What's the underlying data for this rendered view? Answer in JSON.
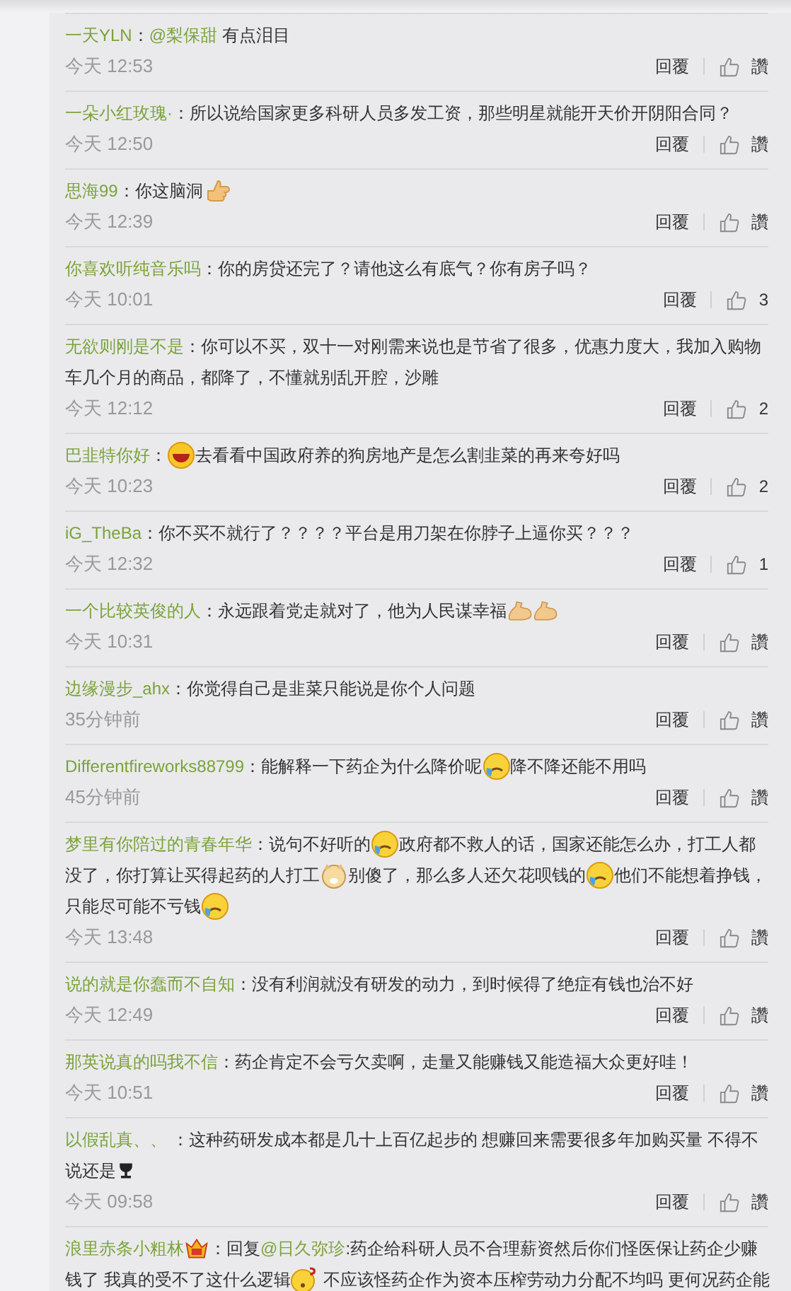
{
  "comments": [
    {
      "author": "一天YLN",
      "lines": [
        [
          {
            "kind": "text",
            "text": "："
          },
          {
            "kind": "mention",
            "text": "@梨保甜"
          },
          {
            "kind": "text",
            "text": " 有点泪目"
          }
        ]
      ],
      "time": "今天 12:53",
      "reply": "回覆",
      "likes": "讚"
    },
    {
      "author": "一朵小红玫瑰·",
      "lines": [
        [
          {
            "kind": "text",
            "text": "：所以说给国家更多科研人员多发工资，那些明星就能开天价开阴阳合同？"
          }
        ]
      ],
      "time": "今天 12:50",
      "reply": "回覆",
      "likes": "讚"
    },
    {
      "author": "思海99",
      "lines": [
        [
          {
            "kind": "text",
            "text": "：你这脑洞"
          },
          {
            "kind": "thumb"
          }
        ]
      ],
      "time": "今天 12:39",
      "reply": "回覆",
      "likes": "讚"
    },
    {
      "author": "你喜欢听纯音乐吗",
      "lines": [
        [
          {
            "kind": "text",
            "text": "：你的房贷还完了？请他这么有底气？你有房子吗？"
          }
        ]
      ],
      "time": "今天 10:01",
      "reply": "回覆",
      "likes": "3"
    },
    {
      "author": "无欲则刚是不是",
      "lines": [
        [
          {
            "kind": "text",
            "text": "：你可以不买，双十一对刚需来说也是节省了很多，优惠力度大，我加入购物"
          }
        ],
        [
          {
            "kind": "text",
            "text": "车几个月的商品，都降了，不懂就别乱开腔，沙雕"
          }
        ]
      ],
      "time": "今天 12:12",
      "reply": "回覆",
      "likes": "2"
    },
    {
      "author": "巴韭特你好",
      "lines": [
        [
          {
            "kind": "text",
            "text": "："
          },
          {
            "kind": "laugh"
          },
          {
            "kind": "text",
            "text": "去看看中国政府养的狗房地产是怎么割韭菜的再来夸好吗"
          }
        ]
      ],
      "time": "今天 10:23",
      "reply": "回覆",
      "likes": "2"
    },
    {
      "author": "iG_TheBa",
      "lines": [
        [
          {
            "kind": "text",
            "text": "：你不买不就行了？？？？平台是用刀架在你脖子上逼你买？？？"
          }
        ]
      ],
      "time": "今天 12:32",
      "reply": "回覆",
      "likes": "1"
    },
    {
      "author": "一个比较英俊的人",
      "lines": [
        [
          {
            "kind": "text",
            "text": "：永远跟着党走就对了，他为人民谋幸福"
          },
          {
            "kind": "flex"
          },
          {
            "kind": "flex"
          }
        ]
      ],
      "time": "今天 10:31",
      "reply": "回覆",
      "likes": "讚"
    },
    {
      "author": "边缘漫步_ahx",
      "lines": [
        [
          {
            "kind": "text",
            "text": "：你觉得自己是韭菜只能说是你个人问题"
          }
        ]
      ],
      "time": "35分钟前",
      "reply": "回覆",
      "likes": "讚"
    },
    {
      "author": "Differentfireworks88799",
      "lines": [
        [
          {
            "kind": "text",
            "text": "：能解释一下药企为什么降价呢"
          },
          {
            "kind": "cry"
          },
          {
            "kind": "text",
            "text": "降不降还能不用吗"
          }
        ]
      ],
      "time": "45分钟前",
      "reply": "回覆",
      "likes": "讚"
    },
    {
      "author": "梦里有你陪过的青春年华",
      "lines": [
        [
          {
            "kind": "text",
            "text": "：说句不好听的"
          },
          {
            "kind": "cry"
          },
          {
            "kind": "text",
            "text": "政府都不救人的话，国家还能怎么办，打工人都"
          }
        ],
        [
          {
            "kind": "text",
            "text": "没了，你打算让买得起药的人打工"
          },
          {
            "kind": "doge"
          },
          {
            "kind": "text",
            "text": "别傻了，那么多人还欠花呗钱的"
          },
          {
            "kind": "cry"
          },
          {
            "kind": "text",
            "text": "他们不能想着挣钱，"
          }
        ],
        [
          {
            "kind": "text",
            "text": "只能尽可能不亏钱"
          },
          {
            "kind": "cry"
          }
        ]
      ],
      "time": "今天 13:48",
      "reply": "回覆",
      "likes": "讚"
    },
    {
      "author": "说的就是你蠢而不自知",
      "lines": [
        [
          {
            "kind": "text",
            "text": "：没有利润就没有研发的动力，到时候得了绝症有钱也治不好"
          }
        ]
      ],
      "time": "今天 12:49",
      "reply": "回覆",
      "likes": "讚"
    },
    {
      "author": "那英说真的吗我不信",
      "lines": [
        [
          {
            "kind": "text",
            "text": "：药企肯定不会亏欠卖啊，走量又能赚钱又能造福大众更好哇！"
          }
        ]
      ],
      "time": "今天 10:51",
      "reply": "回覆",
      "likes": "讚"
    },
    {
      "author": "以假乱真、、",
      "lines": [
        [
          {
            "kind": "text",
            "text": " ：这种药研发成本都是几十上百亿起步的 想赚回来需要很多年加购买量 不得不"
          }
        ],
        [
          {
            "kind": "text",
            "text": "说还是"
          },
          {
            "kind": "trophy"
          }
        ]
      ],
      "time": "今天 09:58",
      "reply": "回覆",
      "likes": "讚"
    },
    {
      "author": "浪里赤条小粗林",
      "lines": [
        [
          {
            "kind": "crown"
          },
          {
            "kind": "text",
            "text": "：回复"
          },
          {
            "kind": "mention",
            "text": "@日久弥珍"
          },
          {
            "kind": "text",
            "text": ":药企给科研人员不合理薪资然后你们怪医保让药企少赚"
          }
        ],
        [
          {
            "kind": "text",
            "text": "钱了 我真的受不了这什么逻辑"
          },
          {
            "kind": "confused"
          },
          {
            "kind": "text",
            "text": " 不应该怪药企作为资本压榨劳动力分配不均吗 更何况药企能"
          }
        ]
      ]
    }
  ]
}
